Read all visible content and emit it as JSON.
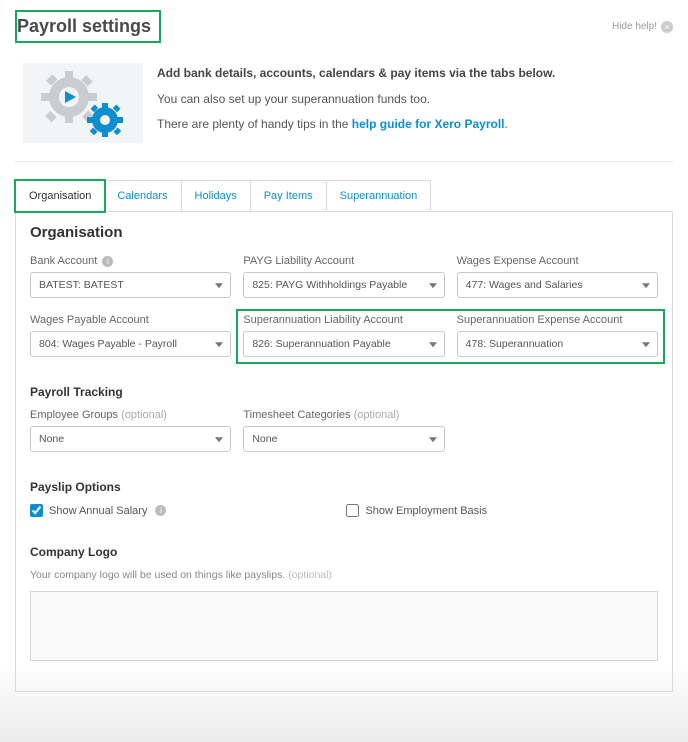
{
  "header": {
    "title": "Payroll settings",
    "hideHelp": "Hide help!"
  },
  "intro": {
    "headline": "Add bank details, accounts, calendars & pay items via the tabs below.",
    "line2": "You can also set up your superannuation funds too.",
    "line3_pre": "There are plenty of handy tips in the ",
    "line3_link": "help guide for Xero Payroll",
    "line3_post": "."
  },
  "tabs": {
    "items": [
      {
        "label": "Organisation",
        "active": true
      },
      {
        "label": "Calendars",
        "active": false
      },
      {
        "label": "Holidays",
        "active": false
      },
      {
        "label": "Pay Items",
        "active": false
      },
      {
        "label": "Superannuation",
        "active": false
      }
    ]
  },
  "panel": {
    "title": "Organisation"
  },
  "fields": {
    "bankAccount": {
      "label": "Bank Account",
      "value": "BATEST: BATEST"
    },
    "paygLiability": {
      "label": "PAYG Liability Account",
      "value": "825: PAYG Withholdings Payable"
    },
    "wagesExpense": {
      "label": "Wages Expense Account",
      "value": "477: Wages and Salaries"
    },
    "wagesPayable": {
      "label": "Wages Payable Account",
      "value": "804: Wages Payable - Payroll"
    },
    "superLiability": {
      "label": "Superannuation Liability Account",
      "value": "826: Superannuation Payable"
    },
    "superExpense": {
      "label": "Superannuation Expense Account",
      "value": "478: Superannuation"
    }
  },
  "tracking": {
    "title": "Payroll Tracking",
    "employeeGroups": {
      "label": "Employee Groups",
      "optional": "(optional)",
      "value": "None"
    },
    "timesheetCats": {
      "label": "Timesheet Categories",
      "optional": "(optional)",
      "value": "None"
    }
  },
  "payslip": {
    "title": "Payslip Options",
    "showAnnual": {
      "label": "Show Annual Salary",
      "checked": true
    },
    "showBasis": {
      "label": "Show Employment Basis",
      "checked": false
    }
  },
  "logo": {
    "title": "Company Logo",
    "hint": "Your company logo will be used on things like payslips.",
    "optional": "(optional)"
  }
}
